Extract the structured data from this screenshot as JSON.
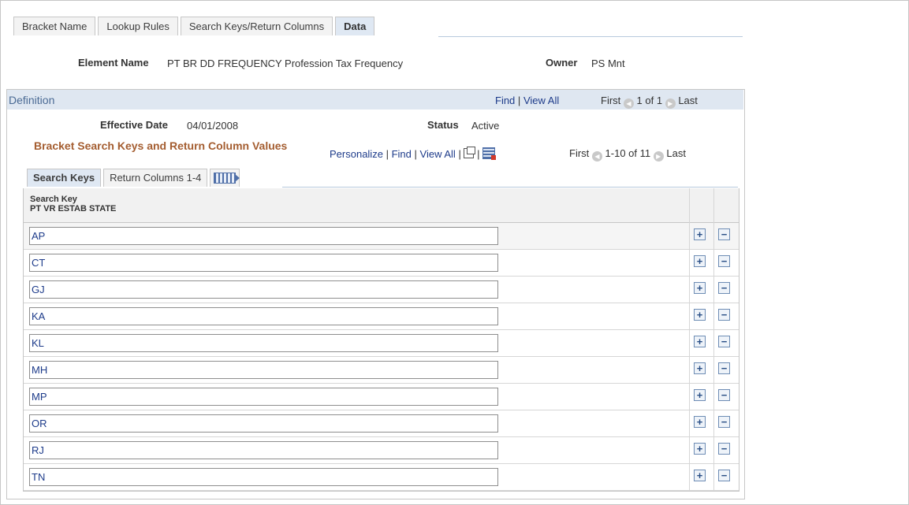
{
  "tabs": [
    {
      "label": "Bracket Name",
      "active": false
    },
    {
      "label": "Lookup Rules",
      "active": false
    },
    {
      "label": "Search Keys/Return Columns",
      "active": false
    },
    {
      "label": "Data",
      "active": true
    }
  ],
  "element": {
    "label": "Element Name",
    "value": "PT BR DD FREQUENCY Profession Tax Frequency",
    "owner_label": "Owner",
    "owner_value": "PS Mnt"
  },
  "definition": {
    "title": "Definition",
    "find": "Find",
    "view_all": "View All",
    "first": "First",
    "counter": "1 of 1",
    "last": "Last",
    "effective_date_label": "Effective Date",
    "effective_date": "04/01/2008",
    "status_label": "Status",
    "status": "Active"
  },
  "grid": {
    "title": "Bracket Search Keys and Return Column Values",
    "personalize": "Personalize",
    "find": "Find",
    "view_all": "View All",
    "first": "First",
    "counter": "1-10 of 11",
    "last": "Last",
    "subtabs": [
      {
        "label": "Search Keys",
        "active": true
      },
      {
        "label": "Return Columns 1-4",
        "active": false
      }
    ],
    "column_header_1": "Search Key",
    "column_header_2": "PT VR ESTAB STATE",
    "rows": [
      "AP",
      "CT",
      "GJ",
      "KA",
      "KL",
      "MH",
      "MP",
      "OR",
      "RJ",
      "TN"
    ],
    "add_symbol": "+",
    "delete_symbol": "−"
  },
  "colors": {
    "link": "#1d3b8a",
    "grid_title": "#a45d30",
    "header_bg": "#dfe7f1"
  }
}
